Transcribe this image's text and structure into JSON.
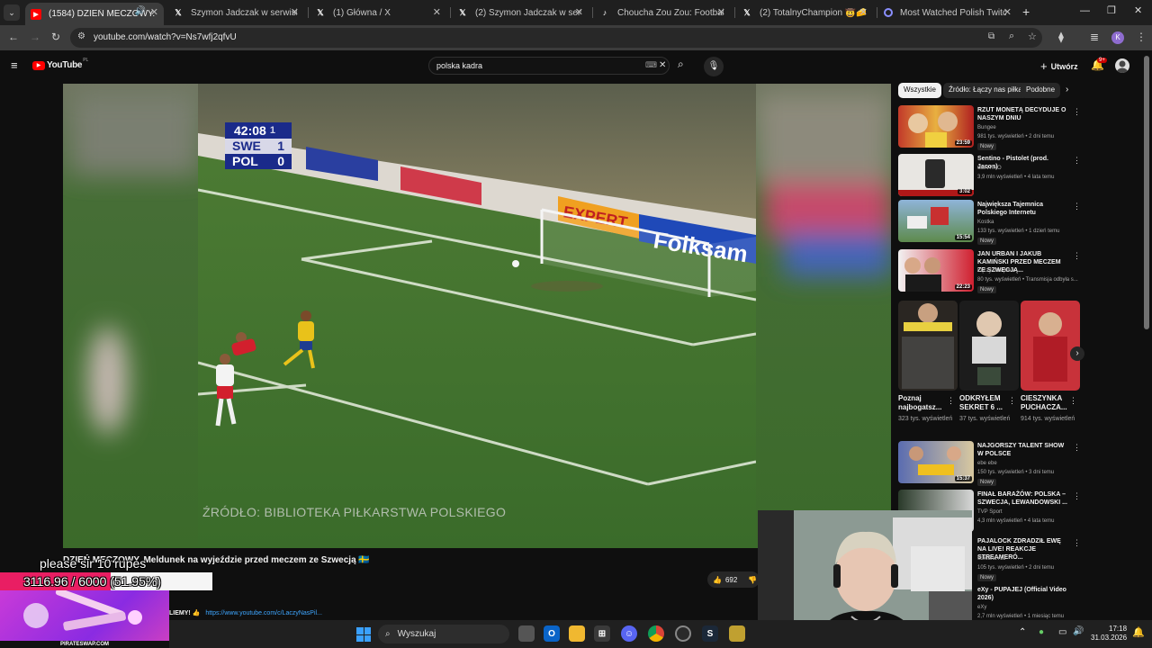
{
  "browser": {
    "tabs": [
      {
        "title": "(1584) DZIEŃ MECZOWY. M",
        "active": true,
        "icon": "youtube-icon"
      },
      {
        "title": "Szymon Jadczak w serwisie X:",
        "icon": "x-icon"
      },
      {
        "title": "(1) Główna / X",
        "icon": "x-icon"
      },
      {
        "title": "(2) Szymon Jadczak w serwisie",
        "icon": "x-icon"
      },
      {
        "title": "Choucha Zou Zou: Football &",
        "icon": "tiktok-icon"
      },
      {
        "title": "(2) TotalnyChampion 🤠🧀 w",
        "icon": "x-icon"
      },
      {
        "title": "Most Watched Polish Twitch St",
        "icon": "site-icon"
      }
    ],
    "url": "youtube.com/watch?v=Ns7wfj2qfvU"
  },
  "youtube": {
    "logo": "YouTube",
    "logo_region": "PL",
    "search_value": "polska kadra",
    "create_label": "Utwórz",
    "notifications_badge": "9+",
    "avatar_letter": "K"
  },
  "video": {
    "score_time": "42:08",
    "score_half": "1",
    "team1": "SWE",
    "score1": "1",
    "team2": "POL",
    "score2": "0",
    "ad_boards": [
      "Folksam",
      "EXPERT"
    ],
    "source_caption": "ŹRÓDŁO: BIBLIOTEKA PIŁKARSTWA POLSKIEGO",
    "title": "DZIEŃ MECZOWY. Meldunek na wyjeździe przed meczem ze Szwecją 🇸🇪",
    "likes": "692",
    "description_snippet": "LIEMY! 👍",
    "description_link": "https://www.youtube.com/c/LaczyNasPil..."
  },
  "chips": [
    "Wszystkie",
    "Źródło: Łączy nas piłka",
    "Podobne"
  ],
  "recommendations": [
    {
      "title": "RZUT MONETĄ DECYDUJE O NASZYM DNIU",
      "channel": "Bungee",
      "meta": "981 tys. wyświetleń • 2 dni temu",
      "duration": "23:59",
      "badge": "Nowy"
    },
    {
      "title": "Sentino - Pistolet (prod. Jacon)",
      "channel": "SENTINO",
      "meta": "3,9 mln wyświetleń • 4 lata temu",
      "duration": "3:02",
      "badge": ""
    },
    {
      "title": "Największa Tajemnica Polskiego Internetu",
      "channel": "Kostka",
      "meta": "133 tys. wyświetleń • 1 dzień temu",
      "duration": "15:54",
      "badge": "Nowy"
    },
    {
      "title": "JAN URBAN I JAKUB KAMIŃSKI PRZED MECZEM ZE SZWECJĄ...",
      "channel": "Łączy nas piłka",
      "meta": "80 tys. wyświetleń • Transmisja odbyła s...",
      "duration": "22:23",
      "badge": "Nowy"
    }
  ],
  "shorts": [
    {
      "title": "Poznaj najbogatsz...",
      "views": "323 tys. wyświetleń"
    },
    {
      "title": "ODKRYŁEM SEKRET 6 ...",
      "views": "37 tys. wyświetleń"
    },
    {
      "title": "CIESZYNKA PUCHACZA...",
      "views": "914 tys. wyświetleń"
    }
  ],
  "recommendations2": [
    {
      "title": "NAJGORSZY TALENT SHOW W POLSCE",
      "channel": "ebe ebe",
      "meta": "150 tys. wyświetleń • 3 dni temu",
      "duration": "15:37",
      "badge": "Nowy"
    },
    {
      "title": "FINAŁ BARAŻÓW: POLSKA – SZWECJA, LEWANDOWSKI ...",
      "channel": "TVP Sport",
      "meta": "4,3 mln wyświetleń • 4 lata temu",
      "duration": "",
      "badge": ""
    },
    {
      "title": "PAJALOCK ZDRADZIŁ EWĘ NA LIVE! REAKCJE STREAMERÓ...",
      "channel": "SzklanaY2J",
      "meta": "105 tys. wyświetleń • 2 dni temu",
      "duration": "",
      "badge": "Nowy"
    },
    {
      "title": "eXy - PUPAJEJ (Official Video 2026)",
      "channel": "eXy",
      "meta": "2,7 mln wyświetleń • 1 miesiąc temu",
      "duration": "",
      "badge": ""
    }
  ],
  "stream_overlay": {
    "chat_message": "please sir  10 rupes",
    "donation_text": "3116.96 / 6000 (51.95%)",
    "donation_fraction": 0.5195,
    "banner_text": "PIRATESWAP.COM"
  },
  "taskbar": {
    "search_label": "Wyszukaj",
    "time": "17:18",
    "date": "31.03.2026"
  },
  "colors": {
    "yt_red": "#ff0000",
    "donation_pink": "#e91e63",
    "pitch_green": "#3d6b2c"
  }
}
